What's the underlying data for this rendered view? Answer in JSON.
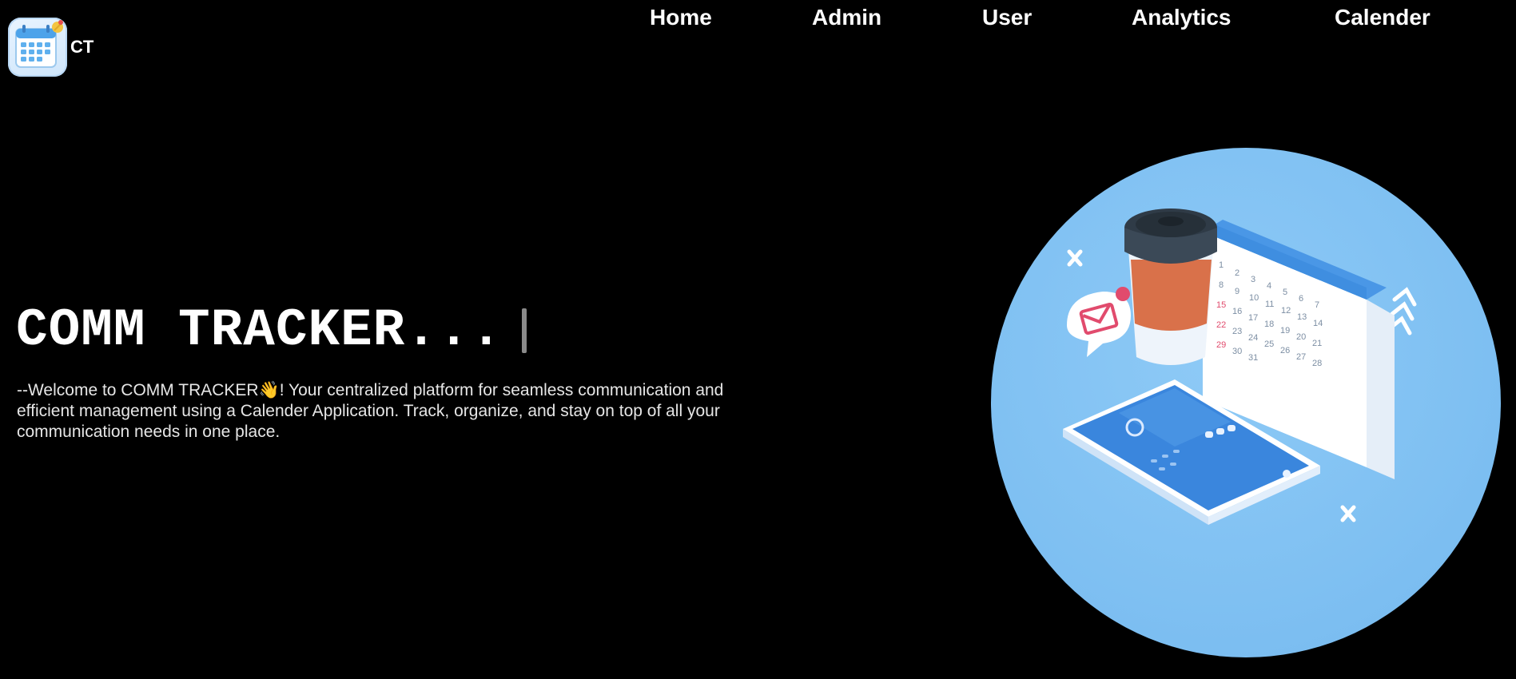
{
  "brand": {
    "logo_text": "CT",
    "logo_icon": "calendar-icon"
  },
  "nav": {
    "items": [
      {
        "label": "Home"
      },
      {
        "label": "Admin"
      },
      {
        "label": "User"
      },
      {
        "label": "Analytics"
      },
      {
        "label": "Calender"
      }
    ]
  },
  "hero": {
    "title": "COMM TRACKER...",
    "intro_prefix": "--Welcome to COMM TRACKER",
    "wave_emoji": "👋",
    "intro_suffix": "! Your centralized platform for seamless communication and efficient management using a Calender Application. Track, organize, and stay on top of all your communication needs in one place.",
    "illustration": "calendar-phone-coffee-illustration"
  },
  "colors": {
    "background": "#000000",
    "text": "#ffffff",
    "illustration_bg": "#7fc0f2",
    "calendar_header": "#3f8ee0",
    "cup_body": "#d9714a",
    "cup_lid": "#2f3b47",
    "phone_screen": "#3a86dd"
  }
}
